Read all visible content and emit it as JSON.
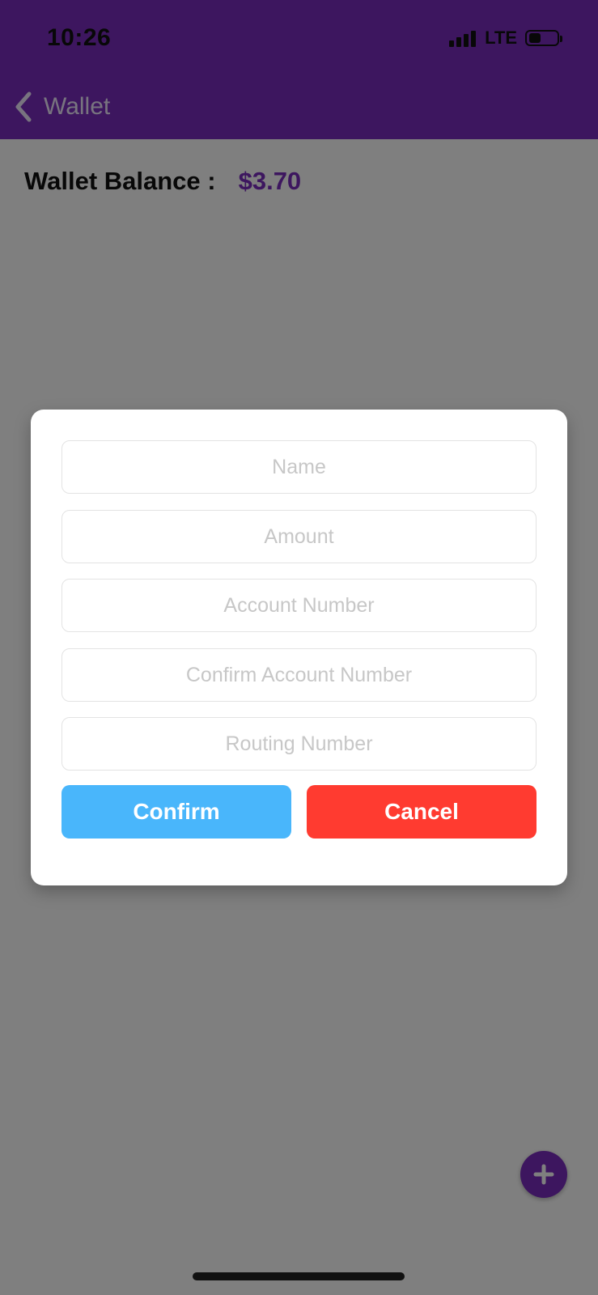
{
  "status_bar": {
    "time": "10:26",
    "network": "LTE"
  },
  "nav": {
    "title": "Wallet"
  },
  "wallet": {
    "balance_label": "Wallet Balance :",
    "balance_value": "$3.70"
  },
  "modal": {
    "fields": [
      {
        "placeholder": "Name",
        "value": ""
      },
      {
        "placeholder": "Amount",
        "value": ""
      },
      {
        "placeholder": "Account Number",
        "value": ""
      },
      {
        "placeholder": "Confirm Account Number",
        "value": ""
      },
      {
        "placeholder": "Routing Number",
        "value": ""
      }
    ],
    "confirm_label": "Confirm",
    "cancel_label": "Cancel"
  },
  "colors": {
    "brand_purple": "#7b2cbf",
    "confirm_blue": "#49b6fb",
    "cancel_red": "#ff3b30"
  },
  "icons": {
    "back": "chevron-left-icon",
    "fab": "plus-icon",
    "signal": "signal-icon",
    "battery": "battery-icon"
  }
}
